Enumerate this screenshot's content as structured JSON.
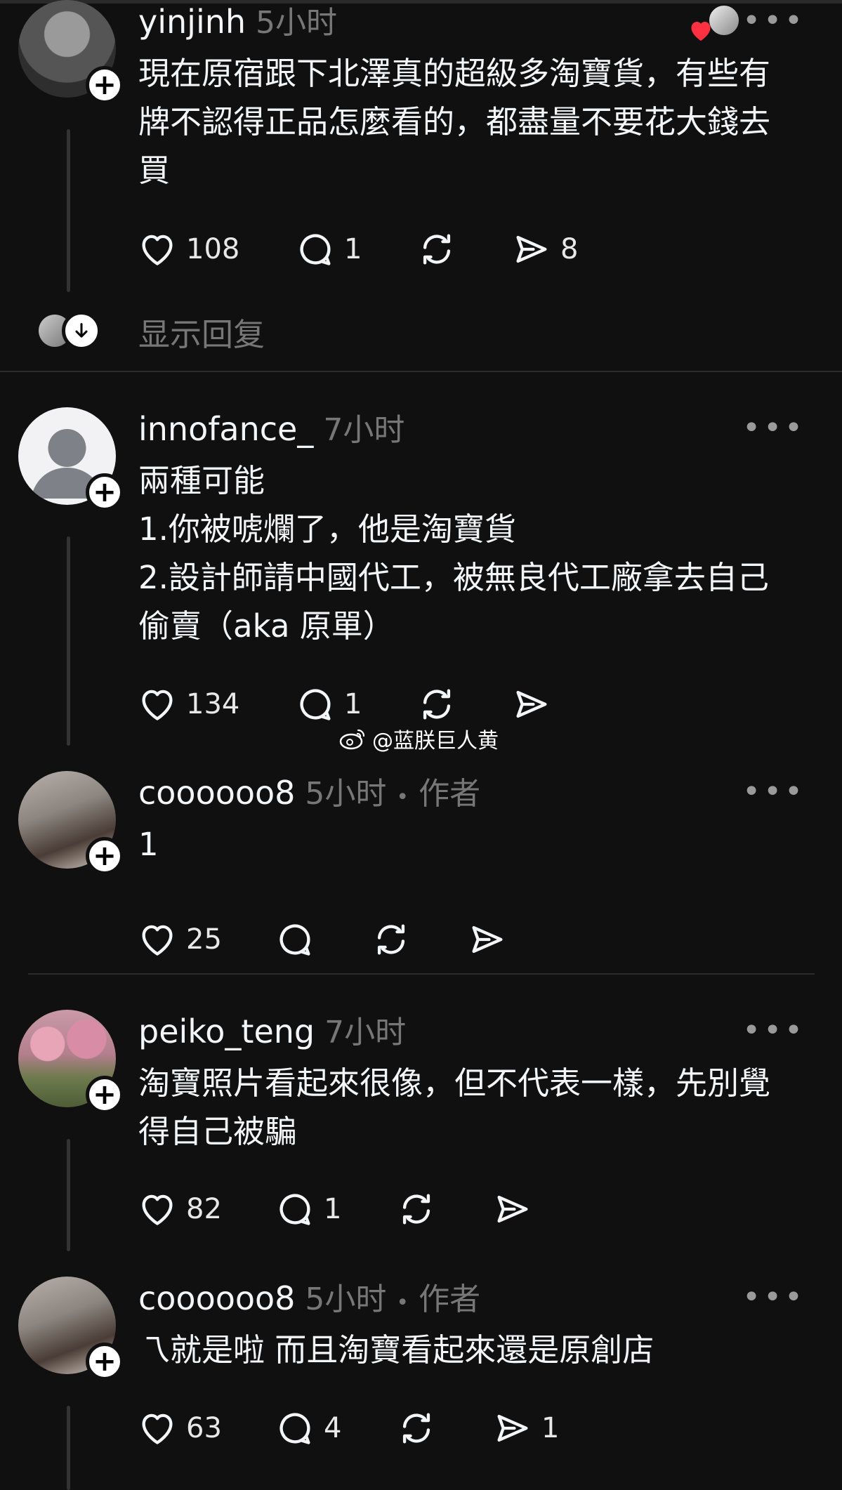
{
  "posts": [
    {
      "username": "yinjinh",
      "time": "5小时",
      "lines": [
        "現在原宿跟下北澤真的超級多淘寶貨，有些有",
        "牌不認得正品怎麼看的，都盡量不要花大錢去",
        "買"
      ],
      "likes": "108",
      "comments": "1",
      "shares": "8"
    },
    {
      "username": "innofance_",
      "time": "7小时",
      "lines": [
        "兩種可能",
        "1.你被唬爛了，他是淘寶貨",
        "2.設計師請中國代工，被無良代工廠拿去自己",
        "偷賣（aka 原單）"
      ],
      "likes": "134",
      "comments": "1",
      "shares": ""
    },
    {
      "username": "coooooo8",
      "time": "5小时",
      "author": "作者",
      "lines": [
        "1"
      ],
      "likes": "25",
      "comments": "",
      "shares": ""
    },
    {
      "username": "peiko_teng",
      "time": "7小时",
      "lines": [
        "淘寶照片看起來很像，但不代表一樣，先別覺",
        "得自己被騙"
      ],
      "likes": "82",
      "comments": "1",
      "shares": ""
    },
    {
      "username": "coooooo8",
      "time": "5小时",
      "author": "作者",
      "lines": [
        "乁就是啦 而且淘寶看起來還是原創店"
      ],
      "likes": "63",
      "comments": "4",
      "shares": "1"
    }
  ],
  "show_replies": "显示回复",
  "more_label": "•••",
  "separator_dot": "•",
  "watermark": "@蓝朕巨人黄",
  "colors": {
    "background": "#101010",
    "text": "#f3f5f7",
    "muted": "#777777",
    "heart": "#ff3040"
  }
}
